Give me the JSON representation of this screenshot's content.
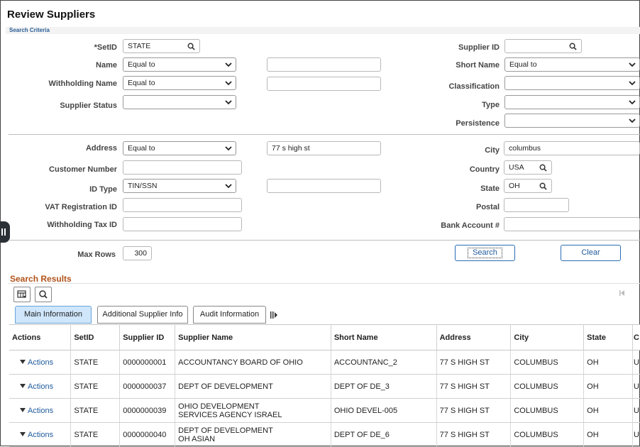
{
  "page": {
    "title": "Review Suppliers",
    "criteria_label": "Search Criteria"
  },
  "left_fields": {
    "setid": {
      "label": "*SetID",
      "value": "STATE"
    },
    "name": {
      "label": "Name",
      "operator": "Equal to",
      "value": ""
    },
    "withholding_name": {
      "label": "Withholding Name",
      "operator": "Equal to",
      "value": ""
    },
    "supplier_status": {
      "label": "Supplier Status",
      "value": ""
    },
    "address": {
      "label": "Address",
      "operator": "Equal to",
      "value": "77 s high st"
    },
    "customer_number": {
      "label": "Customer Number",
      "value": ""
    },
    "id_type": {
      "label": "ID Type",
      "operator": "TIN/SSN",
      "value": ""
    },
    "vat_registration_id": {
      "label": "VAT Registration ID",
      "value": ""
    },
    "withholding_tax_id": {
      "label": "Withholding Tax ID",
      "value": ""
    },
    "max_rows": {
      "label": "Max Rows",
      "value": "300"
    }
  },
  "right_fields": {
    "supplier_id": {
      "label": "Supplier ID",
      "value": ""
    },
    "short_name": {
      "label": "Short Name",
      "operator": "Equal to"
    },
    "classification": {
      "label": "Classification",
      "value": ""
    },
    "type": {
      "label": "Type",
      "value": ""
    },
    "persistence": {
      "label": "Persistence",
      "value": ""
    },
    "city": {
      "label": "City",
      "value": "columbus"
    },
    "country": {
      "label": "Country",
      "value": "USA"
    },
    "state": {
      "label": "State",
      "value": "OH"
    },
    "postal": {
      "label": "Postal",
      "value": ""
    },
    "bank_account": {
      "label": "Bank Account #",
      "value": ""
    }
  },
  "buttons": {
    "search": "Search",
    "clear": "Clear"
  },
  "results": {
    "title": "Search Results",
    "tabs": [
      {
        "label": "Main Information",
        "active": true
      },
      {
        "label": "Additional Supplier Info",
        "active": false
      },
      {
        "label": "Audit Information",
        "active": false
      }
    ],
    "columns": [
      "Actions",
      "SetID",
      "Supplier ID",
      "Supplier Name",
      "Short Name",
      "Address",
      "City",
      "State",
      "C"
    ],
    "rows": [
      {
        "action": "Actions",
        "setid": "STATE",
        "supplier_id": "0000000001",
        "name": "ACCOUNTANCY BOARD OF OHIO",
        "short_name": "ACCOUNTANC_2",
        "address": "77 S HIGH ST",
        "city": "COLUMBUS",
        "state": "OH",
        "c": "U"
      },
      {
        "action": "Actions",
        "setid": "STATE",
        "supplier_id": "0000000037",
        "name": "DEPT OF DEVELOPMENT",
        "short_name": "DEPT OF DE_3",
        "address": "77 S HIGH ST",
        "city": "COLUMBUS",
        "state": "OH",
        "c": "U"
      },
      {
        "action": "Actions",
        "setid": "STATE",
        "supplier_id": "0000000039",
        "name": "OHIO DEVELOPMENT SERVICES AGENCY ISRAEL",
        "short_name": "OHIO DEVEL-005",
        "address": "77 S HIGH ST",
        "city": "COLUMBUS",
        "state": "OH",
        "c": "U"
      },
      {
        "action": "Actions",
        "setid": "STATE",
        "supplier_id": "0000000040",
        "name": "DEPT OF DEVELOPMENT OH ASIAN",
        "short_name": "DEPT OF DE_6",
        "address": "77 S HIGH ST",
        "city": "COLUMBUS",
        "state": "OH",
        "c": "U"
      }
    ]
  },
  "colors": {
    "link": "#1f5a9b",
    "results_title": "#b0531a",
    "active_tab": "#cfe6fb"
  }
}
